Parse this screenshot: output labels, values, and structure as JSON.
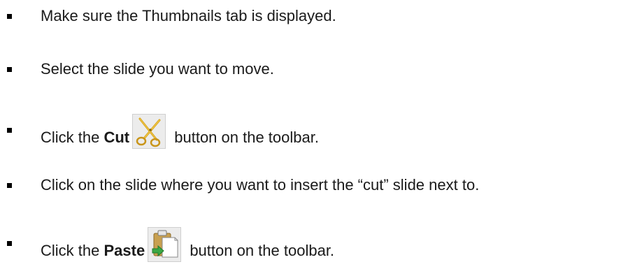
{
  "steps": [
    {
      "text": "Make sure the Thumbnails tab is displayed."
    },
    {
      "text": "Select the slide you want to move."
    },
    {
      "prefix": "Click the ",
      "bold": "Cut",
      "suffix": " button on the toolbar.",
      "icon": "scissors-cut-icon"
    },
    {
      "text": "Click on the slide where you want to insert the “cut” slide next to."
    },
    {
      "prefix": "Click the ",
      "bold": "Paste",
      "suffix": " button on the toolbar.",
      "icon": "clipboard-paste-icon"
    }
  ],
  "colors": {
    "text": "#1a1a1a",
    "bullet": "#000000",
    "icon_background": "#ececec",
    "scissors": "#d9a316",
    "clipboard": "#c8a050",
    "arrow": "#3aa845"
  }
}
